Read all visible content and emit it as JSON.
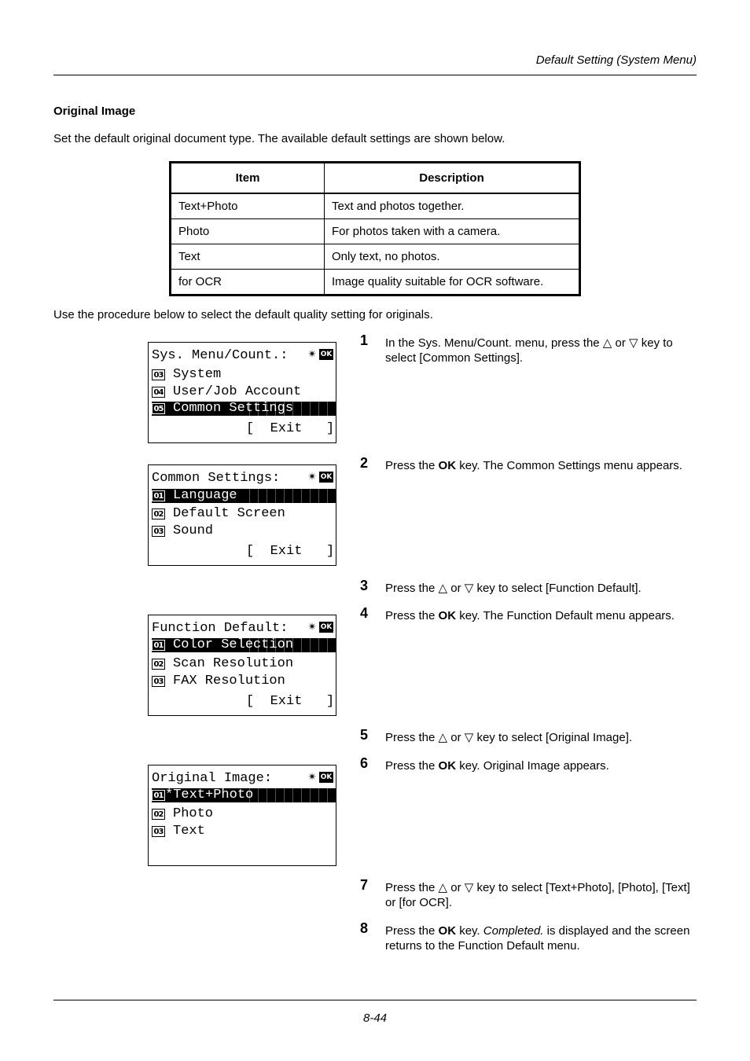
{
  "header": {
    "title": "Default Setting (System Menu)"
  },
  "section": {
    "title": "Original Image",
    "intro": "Set the default original document type. The available default settings are shown below.",
    "procedure_intro": "Use the procedure below to select the default quality setting for originals."
  },
  "table": {
    "headers": [
      "Item",
      "Description"
    ],
    "rows": [
      [
        "Text+Photo",
        "Text and photos together."
      ],
      [
        "Photo",
        "For photos taken with a camera."
      ],
      [
        "Text",
        "Only text, no photos."
      ],
      [
        "for OCR",
        "Image quality suitable for OCR software."
      ]
    ]
  },
  "icons": {
    "nav": "✴",
    "ok": "OK"
  },
  "screens": [
    {
      "title": "Sys. Menu/Count.:",
      "items": [
        {
          "num": "03",
          "label": "System",
          "selected": false
        },
        {
          "num": "04",
          "label": "User/Job Account",
          "selected": false
        },
        {
          "num": "05",
          "label": "Common Settings",
          "selected": true
        }
      ],
      "exit": "[  Exit   ]"
    },
    {
      "title": "Common Settings:",
      "items": [
        {
          "num": "01",
          "label": "Language",
          "selected": true
        },
        {
          "num": "02",
          "label": "Default Screen",
          "selected": false
        },
        {
          "num": "03",
          "label": "Sound",
          "selected": false
        }
      ],
      "exit": "[  Exit   ]"
    },
    {
      "title": "Function Default:",
      "items": [
        {
          "num": "01",
          "label": "Color Selection",
          "selected": true
        },
        {
          "num": "02",
          "label": "Scan Resolution",
          "selected": false
        },
        {
          "num": "03",
          "label": "FAX Resolution",
          "selected": false
        }
      ],
      "exit": "[  Exit   ]"
    },
    {
      "title": "Original Image:",
      "items": [
        {
          "num": "01",
          "label": "*Text+Photo",
          "selected": true
        },
        {
          "num": "02",
          "label": "Photo",
          "selected": false
        },
        {
          "num": "03",
          "label": "Text",
          "selected": false
        }
      ],
      "exit": ""
    }
  ],
  "steps": [
    {
      "n": "1",
      "text": "In the Sys. Menu/Count. menu, press the △ or ▽ key to select [Common Settings]."
    },
    {
      "n": "2",
      "pre": "Press the ",
      "bold": "OK",
      "post": " key. The Common Settings menu appears."
    },
    {
      "n": "3",
      "text": "Press the △ or ▽ key to select [Function Default]."
    },
    {
      "n": "4",
      "pre": "Press the ",
      "bold": "OK",
      "post": " key. The Function Default menu appears."
    },
    {
      "n": "5",
      "text": "Press the △ or ▽ key to select [Original Image]."
    },
    {
      "n": "6",
      "pre": "Press the ",
      "bold": "OK",
      "post": " key. Original Image appears."
    },
    {
      "n": "7",
      "text": "Press the △ or ▽ key to select [Text+Photo], [Photo], [Text] or [for OCR]."
    },
    {
      "n": "8",
      "pre": "Press the ",
      "bold": "OK",
      "mid": " key. ",
      "italic": "Completed.",
      "post": " is displayed and the screen returns to the Function Default menu."
    }
  ],
  "footer": {
    "page": "8-44"
  }
}
